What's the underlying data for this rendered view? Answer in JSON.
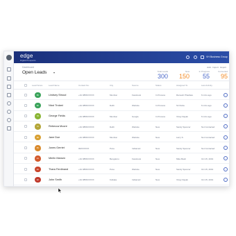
{
  "app": {
    "brand": "edge",
    "brand_sub": "Digital Prospects"
  },
  "topbar": {
    "user": "VH Business Group"
  },
  "header": {
    "crumb": "Dashboard",
    "view_title": "Open Leads",
    "links": "Add · Import · Export"
  },
  "stats": [
    {
      "label": "Total Leads",
      "value": "300",
      "color": "#4a68c8"
    },
    {
      "label": "New",
      "value": "150",
      "color": "#f28c28"
    },
    {
      "label": "In Progress",
      "value": "55",
      "color": "#4a68c8"
    },
    {
      "label": "Converted",
      "value": "95",
      "color": "#f28c28"
    }
  ],
  "columns": [
    "Lead Score",
    "Lead Name",
    "Contact No.",
    "City",
    "Source",
    "Status",
    "Assigned To",
    "Last Activity"
  ],
  "rows": [
    {
      "score": "86",
      "score_color": "#3aa35a",
      "name": "Lindsey Stroud",
      "phone": "+91 9856XXXXX",
      "city": "Mumbai",
      "source": "Facebook",
      "status": "In Process",
      "assigned": "Ramesh Phadtare",
      "activity": "6 mins ago"
    },
    {
      "score": "82",
      "score_color": "#3aa35a",
      "name": "Nicci Troiani",
      "phone": "+91 9856XXXXX",
      "city": "Delhi",
      "source": "Website",
      "status": "In Process",
      "assigned": "Sri Dutta",
      "activity": "6 mins ago"
    },
    {
      "score": "78",
      "score_color": "#8ab534",
      "name": "George Fields",
      "phone": "+91 9856XXXXX",
      "city": "Mumbai",
      "source": "Google",
      "status": "In Process",
      "assigned": "Vinay Nayak",
      "activity": "6 mins ago"
    },
    {
      "score": "72",
      "score_color": "#b3a536",
      "name": "Rebecca Moore",
      "phone": "+91 9856XXXXX",
      "city": "Delhi",
      "source": "Website",
      "status": "New",
      "assigned": "Sandy Spencer",
      "activity": "Not Contacted"
    },
    {
      "score": "68",
      "score_color": "#d8a032",
      "name": "Jane Doe",
      "phone": "+91 9856XXXXX",
      "city": "Mumbai",
      "source": "Website",
      "status": "New",
      "assigned": "Larry S.",
      "activity": "Not Contacted"
    },
    {
      "score": "55",
      "score_color": "#d98a2c",
      "name": "Jones Gerriet",
      "phone": "99XXXXXX",
      "city": "Pune",
      "source": "Indiamart",
      "status": "New",
      "assigned": "Sandy Spencer",
      "activity": "Not Contacted"
    },
    {
      "score": "44",
      "score_color": "#d35a2c",
      "name": "Merlin Marsen",
      "phone": "+91 9856XXXXX",
      "city": "Bengaluru",
      "source": "Facebook",
      "status": "New",
      "assigned": "Mike Bash",
      "activity": "Oct 15, 2019"
    },
    {
      "score": "40",
      "score_color": "#c9452c",
      "name": "Thara Ferdinand",
      "phone": "+91 9856XXXXX",
      "city": "Pune",
      "source": "Website",
      "status": "New",
      "assigned": "Sandy Spencer",
      "activity": "Oct 15, 2019"
    },
    {
      "score": "32",
      "score_color": "#c03a2c",
      "name": "John Smith",
      "phone": "+91 9856XXXXX",
      "city": "Kolkata",
      "source": "Indiamart",
      "status": "New",
      "assigned": "Vinay Nayak",
      "activity": "Oct 15, 2019"
    }
  ]
}
